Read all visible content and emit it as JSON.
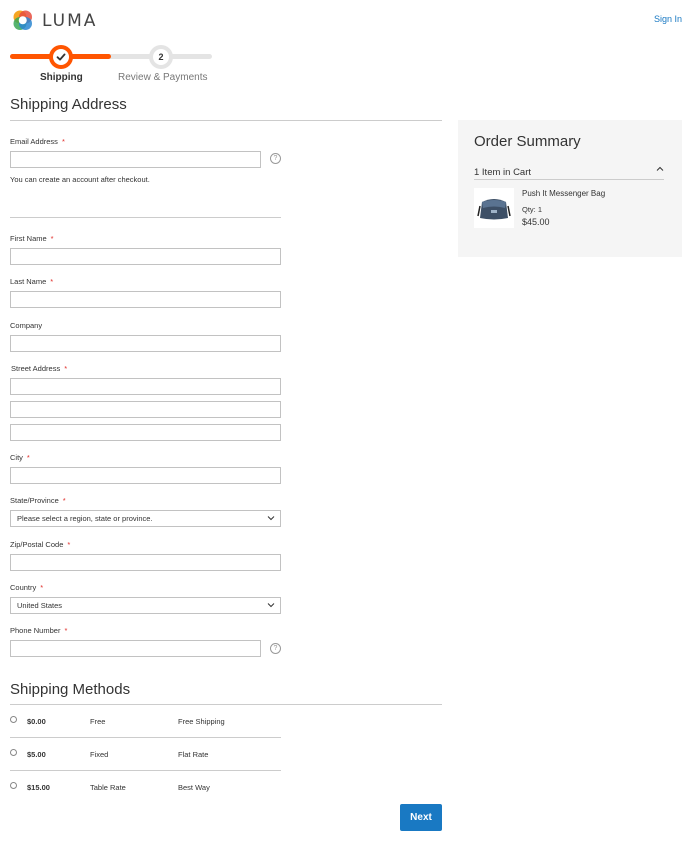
{
  "header": {
    "brand": "LUMA",
    "signin_label": "Sign In"
  },
  "progress": {
    "steps": [
      {
        "label": "Shipping",
        "state": "complete"
      },
      {
        "label": "Review & Payments",
        "number": "2",
        "state": "pending"
      }
    ]
  },
  "shipping_address": {
    "title": "Shipping Address",
    "email_label": "Email Address",
    "email_value": "",
    "email_note": "You can create an account after checkout.",
    "first_name_label": "First Name",
    "last_name_label": "Last Name",
    "company_label": "Company",
    "street_label": "Street Address",
    "city_label": "City",
    "state_label": "State/Province",
    "state_value": "Please select a region, state or province.",
    "zip_label": "Zip/Postal Code",
    "country_label": "Country",
    "country_value": "United States",
    "phone_label": "Phone Number",
    "required_mark": "*",
    "help_glyph": "?"
  },
  "shipping_methods": {
    "title": "Shipping Methods",
    "rows": [
      {
        "price": "$0.00",
        "type": "Free",
        "carrier": "Free Shipping"
      },
      {
        "price": "$5.00",
        "type": "Fixed",
        "carrier": "Flat Rate"
      },
      {
        "price": "$15.00",
        "type": "Table Rate",
        "carrier": "Best Way"
      }
    ]
  },
  "next_label": "Next",
  "summary": {
    "title": "Order Summary",
    "cart_count": "1 Item in Cart",
    "product_name": "Push It Messenger Bag",
    "product_qty": "Qty: 1",
    "product_price": "$45.00"
  },
  "colors": {
    "accent": "#ff5501",
    "primary": "#1979c3",
    "required": "#e02b27"
  }
}
